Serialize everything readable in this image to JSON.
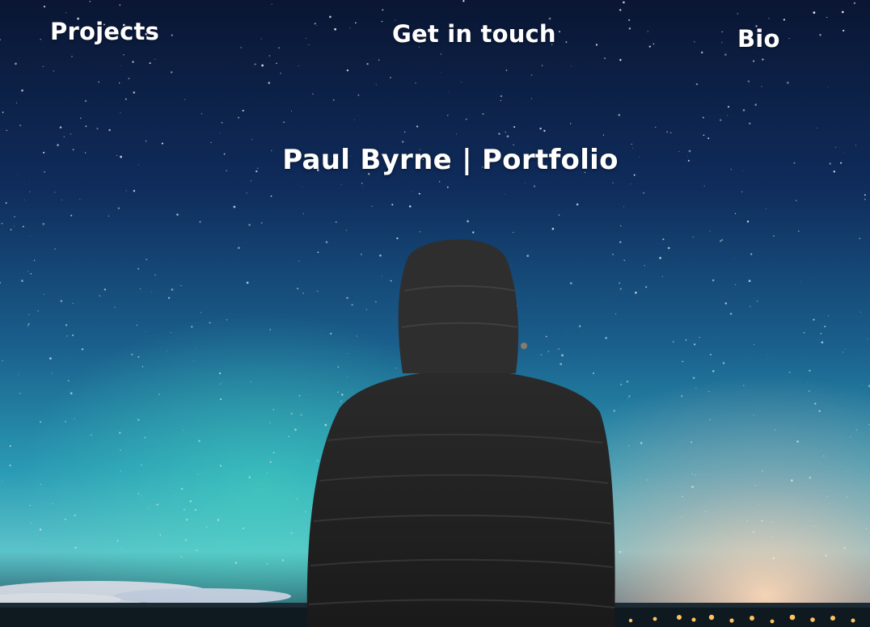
{
  "nav": {
    "projects": "Projects",
    "contact": "Get in touch",
    "bio": "Bio"
  },
  "hero": {
    "title": "Paul Byrne | Portfolio",
    "image": "night-sky-aurora-person-in-hooded-jacket"
  },
  "colors": {
    "sky_top": "#0b1a3a",
    "sky_mid": "#1a5f8c",
    "horizon": "#2fb3c7",
    "glow": "#f3c9a8",
    "jacket": "#262626",
    "text": "#ffffff"
  }
}
